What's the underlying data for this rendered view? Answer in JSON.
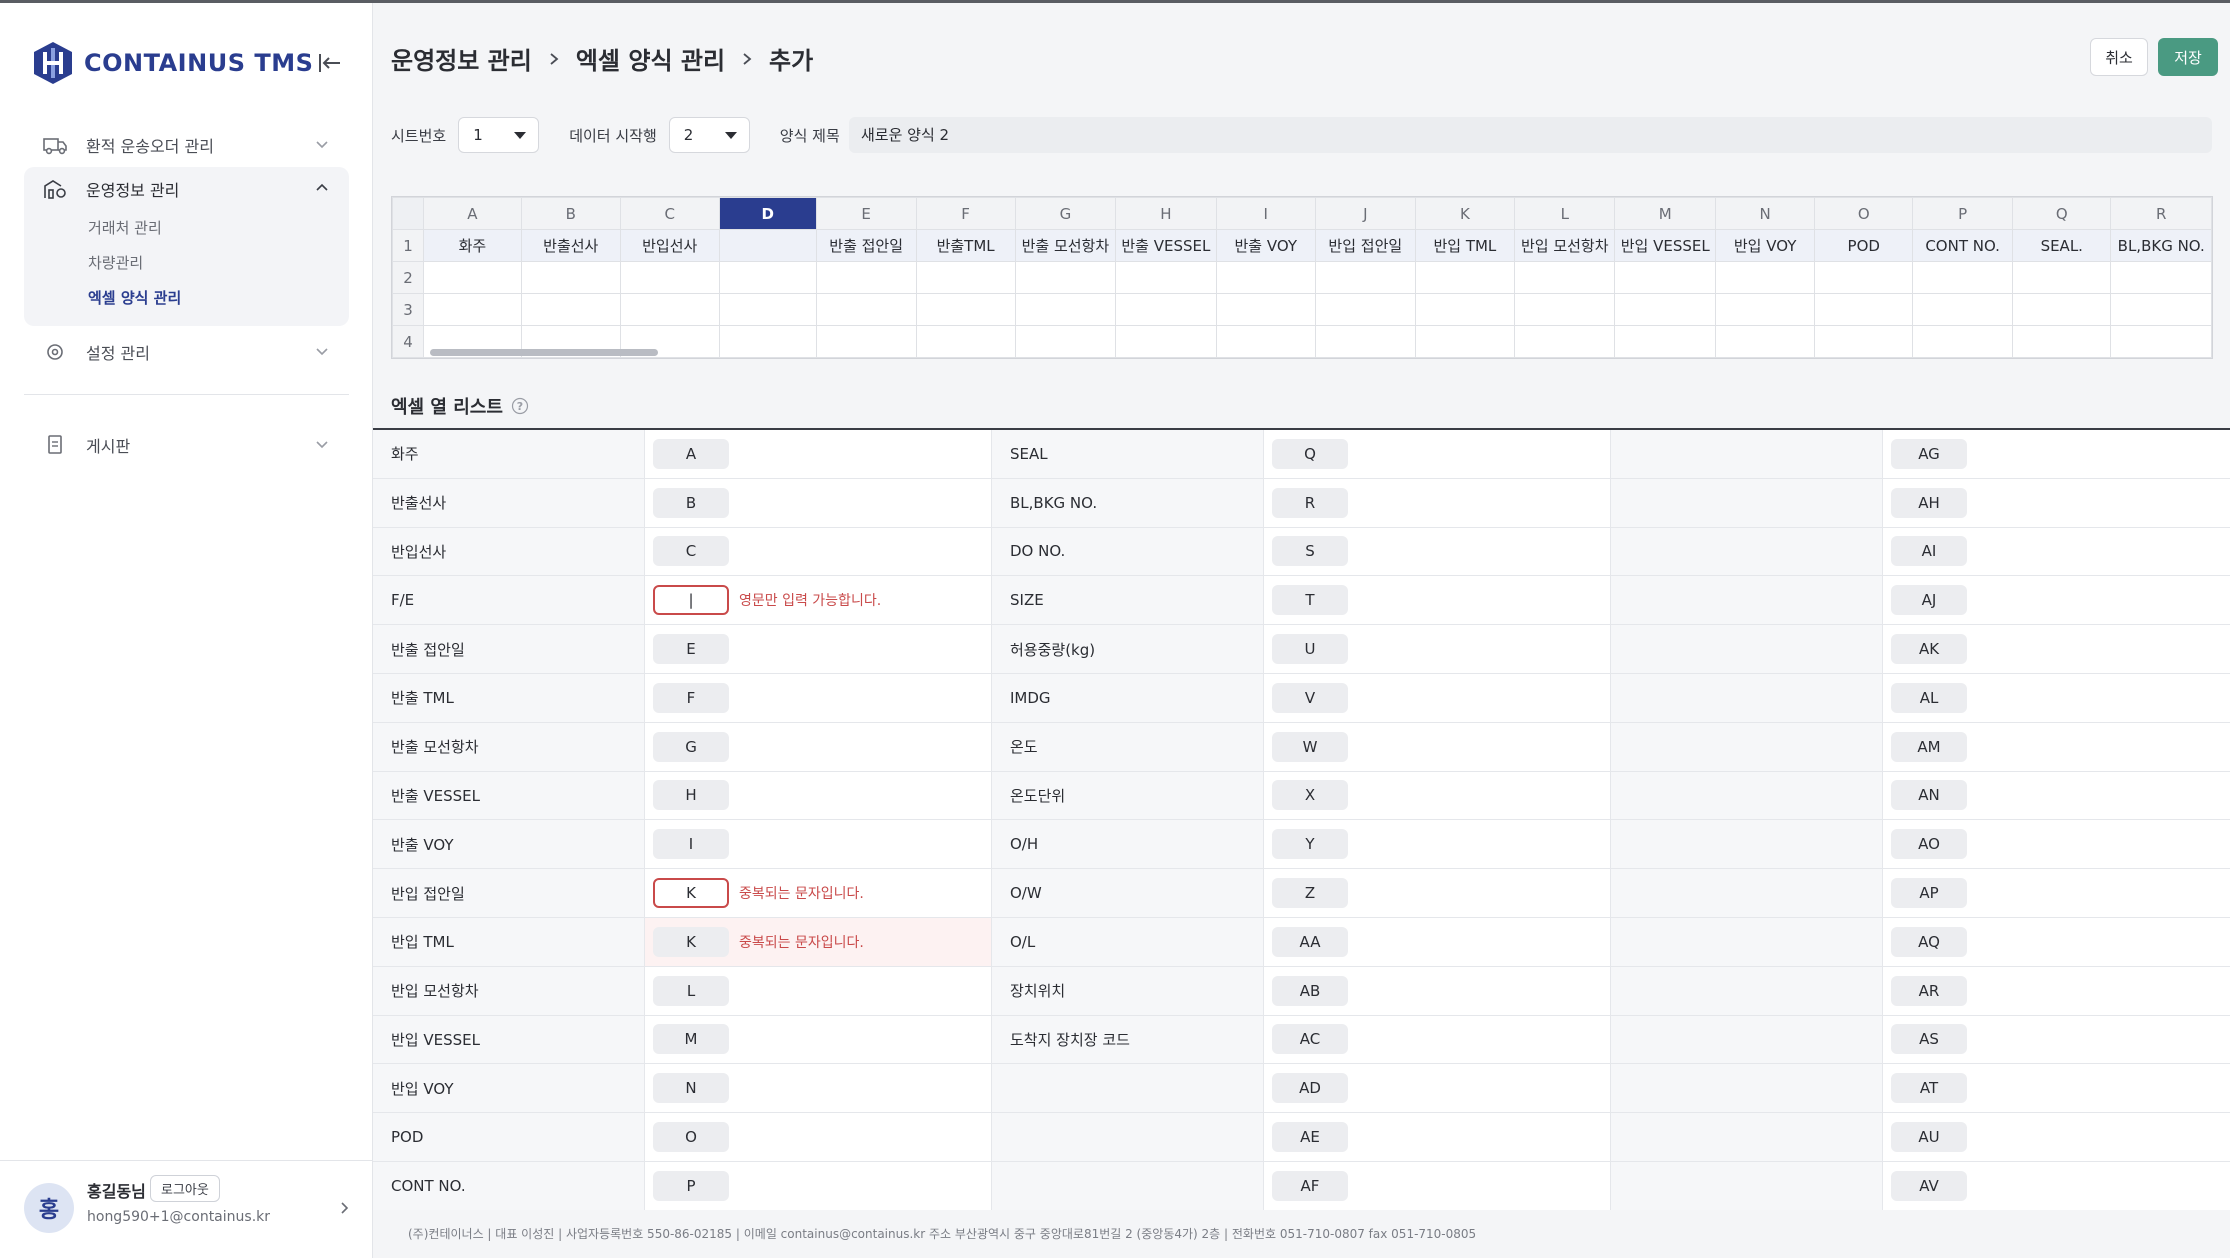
{
  "app": {
    "logo_text": "CONTAINUS TMS"
  },
  "sidebar": {
    "items": [
      {
        "label": "환적 운송오더 관리"
      },
      {
        "label": "운영정보 관리",
        "subitems": [
          "거래처 관리",
          "차량관리",
          "엑셀 양식 관리"
        ]
      },
      {
        "label": "설정 관리"
      },
      {
        "label": "게시판"
      }
    ],
    "user": {
      "avatar": "홍",
      "name": "홍길동님",
      "logout": "로그아웃",
      "email": "hong590+1@containus.kr"
    }
  },
  "header": {
    "crumbs": [
      "운영정보 관리",
      "엑셀 양식 관리",
      "추가"
    ],
    "cancel": "취소",
    "save": "저장"
  },
  "form": {
    "sheet_label": "시트번호",
    "sheet_value": "1",
    "start_label": "데이터 시작행",
    "start_value": "2",
    "title_label": "양식 제목",
    "title_value": "새로운 양식 2"
  },
  "sheet": {
    "cols": [
      "A",
      "B",
      "C",
      "D",
      "E",
      "F",
      "G",
      "H",
      "I",
      "J",
      "K",
      "L",
      "M",
      "N",
      "O",
      "P",
      "Q",
      "R"
    ],
    "row1": [
      "화주",
      "반출선사",
      "반입선사",
      "",
      "반출 접안일",
      "반출TML",
      "반출 모선항차",
      "반출 VESSEL",
      "반출 VOY",
      "반입 접안일",
      "반입 TML",
      "반입 모선항차",
      "반입 VESSEL",
      "반입 VOY",
      "POD",
      "CONT NO.",
      "SEAL.",
      "BL,BKG NO."
    ],
    "rows": [
      "1",
      "2",
      "3",
      "4"
    ]
  },
  "list": {
    "title": "엑셀 열 리스트",
    "rows": [
      {
        "l1": "화주",
        "v1": "A",
        "l2": "SEAL",
        "v2": "Q",
        "v3": "AG"
      },
      {
        "l1": "반출선사",
        "v1": "B",
        "l2": "BL,BKG NO.",
        "v2": "R",
        "v3": "AH"
      },
      {
        "l1": "반입선사",
        "v1": "C",
        "l2": "DO NO.",
        "v2": "S",
        "v3": "AI"
      },
      {
        "l1": "F/E",
        "v1": "|",
        "e1": "영문만 입력 가능합니다.",
        "l2": "SIZE",
        "v2": "T",
        "v3": "AJ"
      },
      {
        "l1": "반출 접안일",
        "v1": "E",
        "l2": "허용중량(kg)",
        "v2": "U",
        "v3": "AK"
      },
      {
        "l1": "반출 TML",
        "v1": "F",
        "l2": "IMDG",
        "v2": "V",
        "v3": "AL"
      },
      {
        "l1": "반출 모선항차",
        "v1": "G",
        "l2": "온도",
        "v2": "W",
        "v3": "AM"
      },
      {
        "l1": "반출 VESSEL",
        "v1": "H",
        "l2": "온도단위",
        "v2": "X",
        "v3": "AN"
      },
      {
        "l1": "반출 VOY",
        "v1": "I",
        "l2": "O/H",
        "v2": "Y",
        "v3": "AO"
      },
      {
        "l1": "반입 접안일",
        "v1": "K",
        "e1": "중복되는 문자입니다.",
        "l2": "O/W",
        "v2": "Z",
        "v3": "AP"
      },
      {
        "l1": "반입 TML",
        "v1": "K",
        "e1": "중복되는 문자입니다.",
        "l2": "O/L",
        "v2": "AA",
        "v3": "AQ"
      },
      {
        "l1": "반입 모선항차",
        "v1": "L",
        "l2": "장치위치",
        "v2": "AB",
        "v3": "AR"
      },
      {
        "l1": "반입 VESSEL",
        "v1": "M",
        "l2": "도착지 장치장 코드",
        "v2": "AC",
        "v3": "AS"
      },
      {
        "l1": "반입 VOY",
        "v1": "N",
        "l2": "",
        "v2": "AD",
        "v3": "AT"
      },
      {
        "l1": "POD",
        "v1": "O",
        "l2": "",
        "v2": "AE",
        "v3": "AU"
      },
      {
        "l1": "CONT NO.",
        "v1": "P",
        "l2": "",
        "v2": "AF",
        "v3": "AV"
      }
    ]
  },
  "footer": "(주)컨테이너스 | 대표 이성진 | 사업자등록번호 550-86-02185 | 이메일 containus@containus.kr    주소 부산광역시 중구 중앙대로81번길 2 (중앙동4가) 2층 | 전화번호 051-710-0807 fax 051-710-0805"
}
